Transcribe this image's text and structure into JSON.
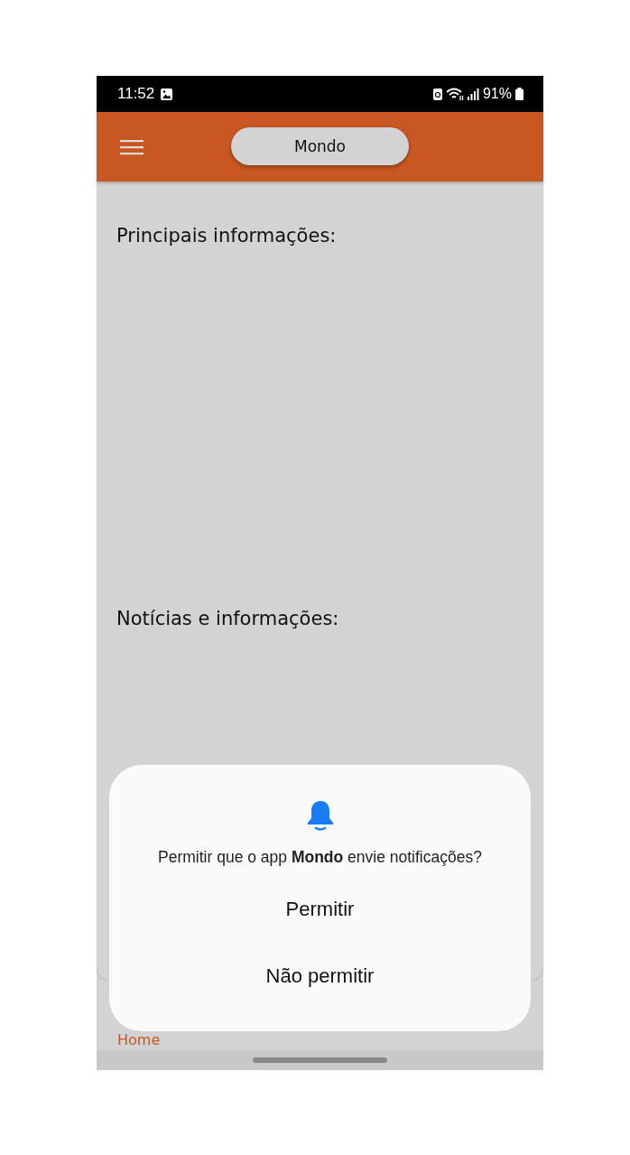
{
  "status_bar": {
    "time": "11:52",
    "battery": "91%"
  },
  "header": {
    "title": "Mondo"
  },
  "sections": [
    {
      "title": "Principais informações:"
    },
    {
      "title": "Notícias e informações:"
    }
  ],
  "bottom_nav": {
    "items": [
      {
        "label": "Home"
      }
    ]
  },
  "dialog": {
    "message": "Permitir que o app **Mondo** envie notificações?",
    "buttons": [
      "Permitir",
      "Não permitir"
    ]
  }
}
